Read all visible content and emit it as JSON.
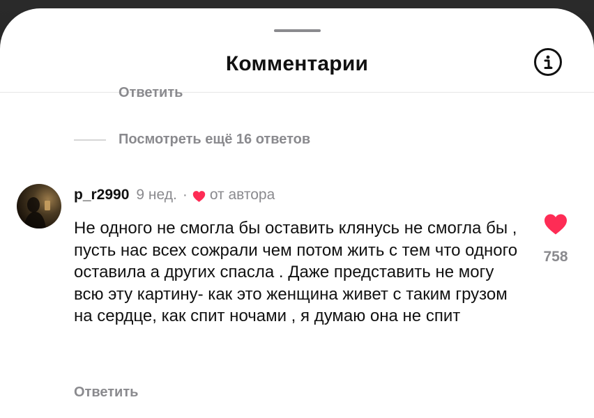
{
  "header": {
    "title": "Комментарии"
  },
  "previous_thread": {
    "reply_label": "Ответить",
    "view_more_label": "Посмотреть ещё 16 ответов"
  },
  "comment": {
    "username": "p_r2990",
    "time": "9 нед.",
    "separator": "·",
    "liked_by_author_label": "от автора",
    "text": "Не одного не смогла бы оставить клянусь не смогла бы , пусть нас всех сожрали чем потом жить с тем что одного оставила а других спасла . Даже представить не могу всю эту картину- как это женщина живет с таким грузом на сердце, как спит ночами , я думаю она не спит",
    "reply_label": "Ответить",
    "like_count": "758",
    "liked": true
  },
  "colors": {
    "heart_red": "#fe2c55",
    "secondary_text": "#8a8a8e",
    "primary_text": "#111111"
  },
  "icons": {
    "info": "info-circle-icon",
    "like": "heart-icon",
    "author_like": "heart-icon"
  }
}
